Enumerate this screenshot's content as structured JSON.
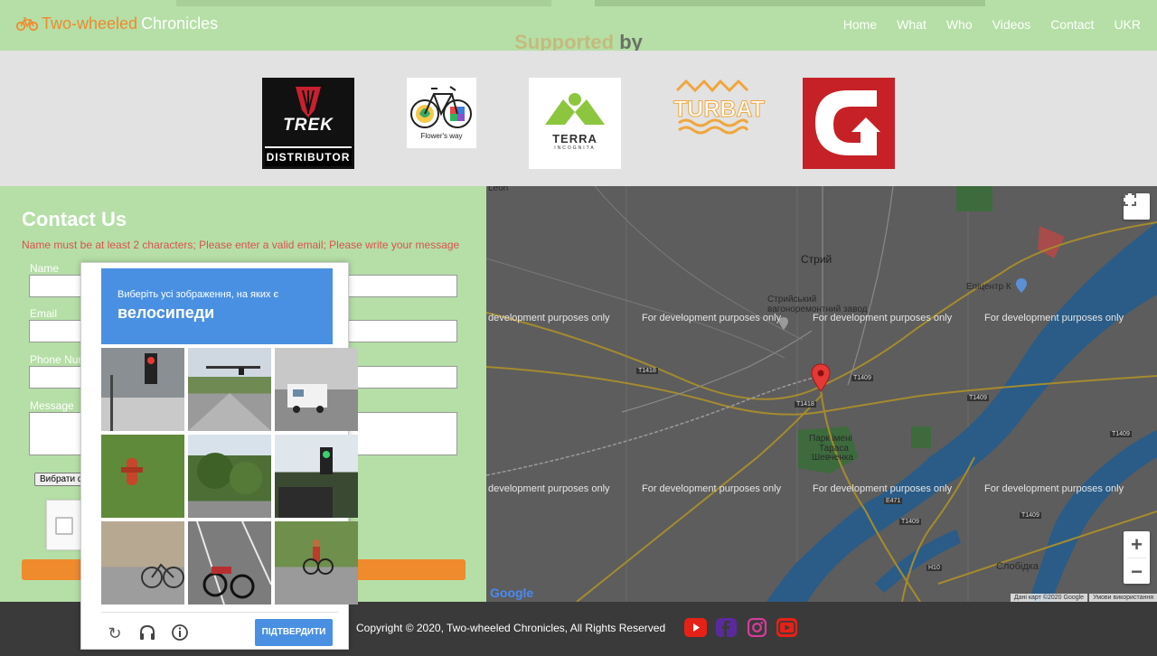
{
  "header": {
    "brand_part1": "Two-wheeled",
    "brand_part2": "Chronicles",
    "supported_part1": "Supported",
    "supported_part2": "by",
    "nav": [
      "Home",
      "What",
      "Who",
      "Videos",
      "Contact",
      "UKR"
    ]
  },
  "sponsors": {
    "trek_top": "TREK",
    "trek_bottom": "DISTRIBUTOR",
    "flower_caption": "Flower's way",
    "terra_caption": "TERRA",
    "terra_sub": "INCOGNITA",
    "turbat_caption": "TURBAT"
  },
  "contact": {
    "title": "Contact Us",
    "errors": "Name must be at least 2 characters; Please enter a valid email; Please write your message",
    "labels": {
      "name": "Name",
      "email": "Email",
      "phone": "Phone Number",
      "message": "Message"
    },
    "file_button": "Вибрати файл"
  },
  "map": {
    "dev_text": "For development purposes only",
    "dev_text_cut": "development purposes only",
    "city_stryi": "Стрий",
    "repair_plant": [
      "Стрийський",
      "вагоноремонтний завод"
    ],
    "park": [
      "Парк імені",
      "Тараса",
      "Шевченка"
    ],
    "epicentr": "Епіцентр К",
    "slobidka": "Слобідка",
    "leon": "Leon",
    "roads": [
      "T1418",
      "T1418",
      "T1409",
      "T1409",
      "E471",
      "T1409",
      "T1409",
      "H10",
      "T1409"
    ],
    "terms": [
      "Дані карт ©2020 Google",
      "Умови використання"
    ],
    "google": "Google"
  },
  "captcha": {
    "instruction": "Виберіть усі зображення, на яких є",
    "target": "велосипеди",
    "verify": "ПІДТВЕРДИТИ"
  },
  "footer": {
    "copyright": "Copyright © 2020, Two-wheeled Chronicles, All Rights Reserved"
  },
  "colors": {
    "green": "#b5dfa6",
    "orange": "#ef8a2d",
    "footer": "#3a3a3a",
    "captcha_blue": "#4a90e2"
  }
}
